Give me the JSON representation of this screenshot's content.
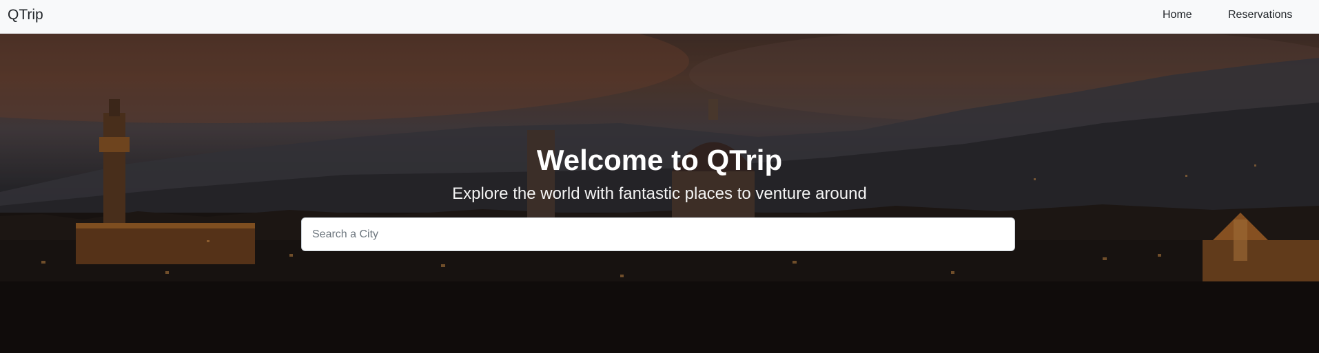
{
  "navbar": {
    "brand": "QTrip",
    "links": [
      {
        "label": "Home"
      },
      {
        "label": "Reservations"
      }
    ]
  },
  "hero": {
    "title": "Welcome to QTrip",
    "subtitle": "Explore the world with fantastic places to venture around",
    "search": {
      "value": "",
      "placeholder": "Search a City"
    },
    "background": "city-skyline-dusk-photo"
  },
  "colors": {
    "navbar_bg": "#f8f9fa",
    "text_dark": "#212529",
    "hero_text": "#ffffff"
  }
}
